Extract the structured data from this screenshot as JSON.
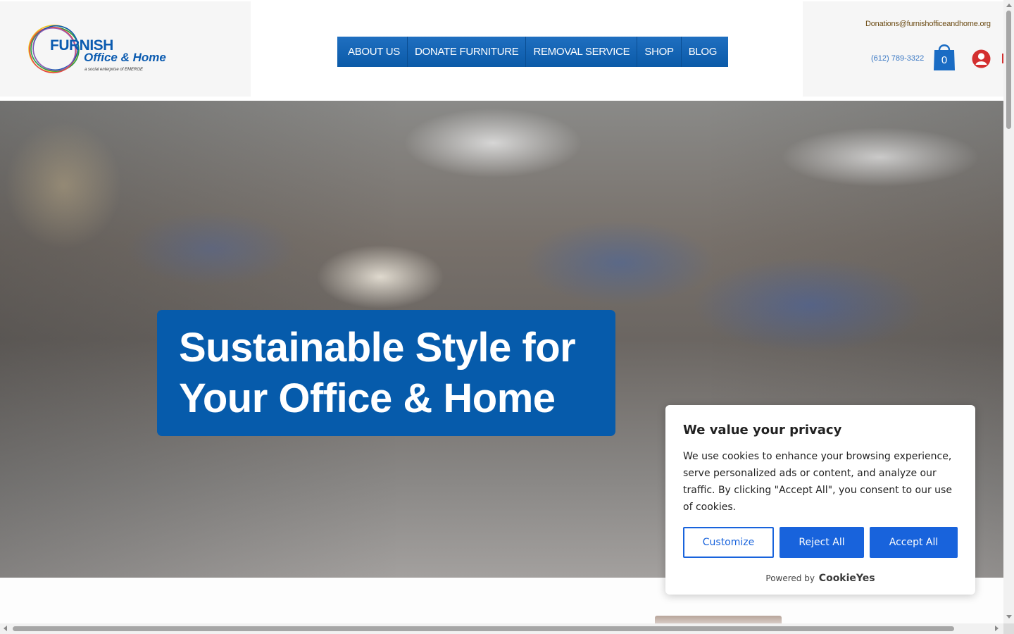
{
  "header": {
    "logo": {
      "name": "FURNISH",
      "subname": "Office & Home",
      "tagline": "a social enterprise of EMERGE",
      "ring_colors": [
        "#f0c419",
        "#2a9d48",
        "#e34b4b",
        "#0b5bb0",
        "#9b59b6"
      ]
    },
    "nav": {
      "items": [
        {
          "label": "ABOUT US"
        },
        {
          "label": "DONATE FURNITURE"
        },
        {
          "label": "REMOVAL SERVICE"
        },
        {
          "label": "SHOP"
        },
        {
          "label": "BLOG"
        }
      ]
    },
    "contact": {
      "email": "Donations@furnishofficeandhome.org",
      "phone": "(612) 789-3322"
    },
    "cart": {
      "count": "0",
      "icon": "shopping-bag-icon"
    },
    "account": {
      "icon": "user-avatar-icon"
    }
  },
  "hero": {
    "heading": "Sustainable Style for Your Office & Home",
    "accent_color": "#065bab"
  },
  "cookie_banner": {
    "title": "We value your privacy",
    "text": "We use cookies to enhance your browsing experience, serve personalized ads or content, and analyze our traffic. By clicking \"Accept All\", you consent to our use of cookies.",
    "customize_label": "Customize",
    "reject_label": "Reject All",
    "accept_label": "Accept All",
    "powered_by": "Powered by",
    "brand": "CookieYes",
    "button_color": "#1863dc"
  }
}
